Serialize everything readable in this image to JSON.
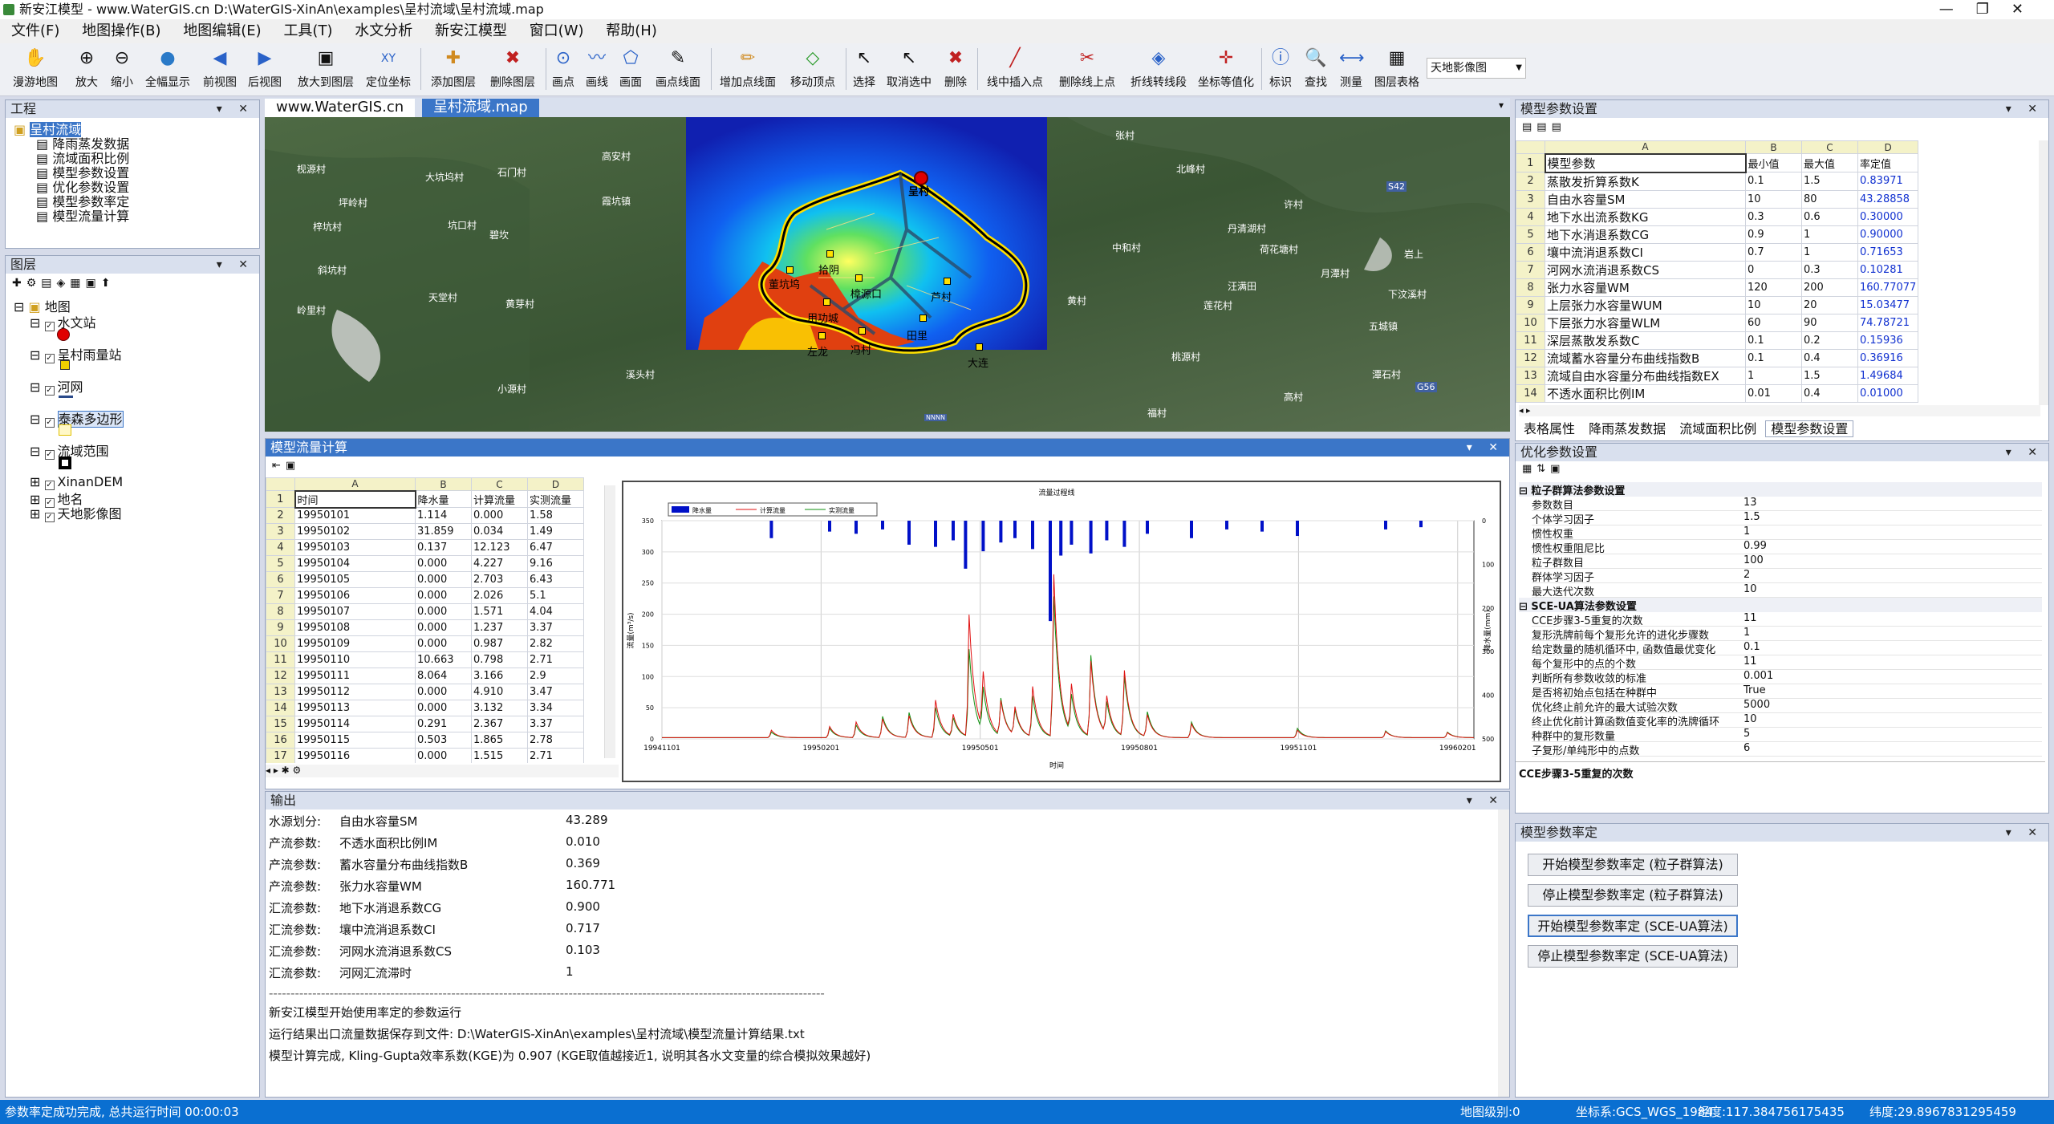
{
  "window": {
    "title": "新安江模型 - www.WaterGIS.cn  D:\\WaterGIS-XinAn\\examples\\呈村流域\\呈村流域.map",
    "controls": [
      "—",
      "❐",
      "✕"
    ]
  },
  "menu": [
    "文件(F)",
    "地图操作(B)",
    "地图编辑(E)",
    "工具(T)",
    "水文分析",
    "新安江模型",
    "窗口(W)",
    "帮助(H)"
  ],
  "toolbar": {
    "buttons": [
      "漫游地图",
      "放大",
      "缩小",
      "全幅显示",
      "前视图",
      "后视图",
      "放大到图层",
      "定位坐标",
      "添加图层",
      "删除图层",
      "画点",
      "画线",
      "画面",
      "画点线面",
      "增加点线面",
      "移动顶点",
      "选择",
      "取消选中",
      "删除",
      "线中插入点",
      "删除线上点",
      "折线转线段",
      "坐标等值化",
      "标识",
      "查找",
      "测量",
      "图层表格"
    ],
    "basemap": "天地影像图"
  },
  "project": {
    "title": "工程",
    "root": "呈村流域",
    "items": [
      "降雨蒸发数据",
      "流域面积比例",
      "模型参数设置",
      "优化参数设置",
      "模型参数率定",
      "模型流量计算"
    ]
  },
  "layers": {
    "title": "图层",
    "root": "地图",
    "items": [
      "水文站",
      "呈村雨量站",
      "河网",
      "泰森多边形",
      "流域范围",
      "XinanDEM",
      "地名",
      "天地影像图"
    ]
  },
  "map_tabs": [
    "www.WaterGIS.cn",
    "呈村流域.map"
  ],
  "map_labels": {
    "villages": [
      "枧源村",
      "坪岭村",
      "大坑坞村",
      "石门村",
      "碧坎",
      "高安村",
      "梓坑村",
      "坑口村",
      "霞坑镇",
      "斜坑村",
      "天堂村",
      "岭里村",
      "黄芽村",
      "张村",
      "中和村",
      "丹清湖村",
      "月潭村",
      "五城镇",
      "莲花村",
      "北峰村",
      "许村",
      "荷花塘村",
      "汪满田",
      "黄村",
      "岩上",
      "桃源村",
      "下汶溪村",
      "高村",
      "潭石村",
      "小源村",
      "溪头村",
      "福村"
    ],
    "stations": [
      "呈村",
      "董坑坞",
      "左龙",
      "用功城",
      "樟源口",
      "冯村",
      "芦村",
      "田里",
      "大连",
      "拾阴"
    ],
    "roads": [
      "S42",
      "G56"
    ],
    "scale": "NNNN"
  },
  "model_param": {
    "title": "模型参数设置",
    "col_letters": [
      "A",
      "B",
      "C",
      "D"
    ],
    "rows": [
      [
        "模型参数",
        "最小值",
        "最大值",
        "率定值"
      ],
      [
        "蒸散发折算系数K",
        "0.1",
        "1.5",
        "0.83971"
      ],
      [
        "自由水容量SM",
        "10",
        "80",
        "43.28858"
      ],
      [
        "地下水出流系数KG",
        "0.3",
        "0.6",
        "0.30000"
      ],
      [
        "地下水消退系数CG",
        "0.9",
        "1",
        "0.90000"
      ],
      [
        "壤中流消退系数CI",
        "0.7",
        "1",
        "0.71653"
      ],
      [
        "河网水流消退系数CS",
        "0",
        "0.3",
        "0.10281"
      ],
      [
        "张力水容量WM",
        "120",
        "200",
        "160.77077"
      ],
      [
        "上层张力水容量WUM",
        "10",
        "20",
        "15.03477"
      ],
      [
        "下层张力水容量WLM",
        "60",
        "90",
        "74.78721"
      ],
      [
        "深层蒸散发系数C",
        "0.1",
        "0.2",
        "0.15936"
      ],
      [
        "流域蓄水容量分布曲线指数B",
        "0.1",
        "0.4",
        "0.36916"
      ],
      [
        "流域自由水容量分布曲线指数EX",
        "1",
        "1.5",
        "1.49684"
      ],
      [
        "不透水面积比例IM",
        "0.01",
        "0.4",
        "0.01000"
      ]
    ],
    "tabs": [
      "表格属性",
      "降雨蒸发数据",
      "流域面积比例",
      "模型参数设置"
    ]
  },
  "flow_calc": {
    "title": "模型流量计算",
    "col_letters": [
      "A",
      "B",
      "C",
      "D"
    ],
    "rows": [
      [
        "时间",
        "降水量",
        "计算流量",
        "实测流量"
      ],
      [
        "19950101",
        "1.114",
        "0.000",
        "1.58"
      ],
      [
        "19950102",
        "31.859",
        "0.034",
        "1.49"
      ],
      [
        "19950103",
        "0.137",
        "12.123",
        "6.47"
      ],
      [
        "19950104",
        "0.000",
        "4.227",
        "9.16"
      ],
      [
        "19950105",
        "0.000",
        "2.703",
        "6.43"
      ],
      [
        "19950106",
        "0.000",
        "2.026",
        "5.1"
      ],
      [
        "19950107",
        "0.000",
        "1.571",
        "4.04"
      ],
      [
        "19950108",
        "0.000",
        "1.237",
        "3.37"
      ],
      [
        "19950109",
        "0.000",
        "0.987",
        "2.82"
      ],
      [
        "19950110",
        "10.663",
        "0.798",
        "2.71"
      ],
      [
        "19950111",
        "8.064",
        "3.166",
        "2.9"
      ],
      [
        "19950112",
        "0.000",
        "4.910",
        "3.47"
      ],
      [
        "19950113",
        "0.000",
        "3.132",
        "3.34"
      ],
      [
        "19950114",
        "0.291",
        "2.367",
        "3.37"
      ],
      [
        "19950115",
        "0.503",
        "1.865",
        "2.78"
      ],
      [
        "19950116",
        "0.000",
        "1.515",
        "2.71"
      ]
    ]
  },
  "chart_data": {
    "type": "line",
    "title": "流量过程线",
    "xlabel": "时间",
    "ylabel": "流量(m³/s)",
    "y2label": "降水量(mm)",
    "legend": [
      "降水量",
      "计算流量",
      "实测流量"
    ],
    "x_ticks": [
      "19941101",
      "19950201",
      "19950501",
      "19950801",
      "19951101",
      "19960201"
    ],
    "y_ticks": [
      "0",
      "50",
      "100",
      "150",
      "200",
      "250",
      "300",
      "350"
    ],
    "y2_ticks": [
      "0",
      "100",
      "200",
      "300",
      "400",
      "500"
    ],
    "ylim": [
      0,
      350
    ],
    "y2lim": [
      0,
      500
    ],
    "series_colors": {
      "rain": "#0010c8",
      "calc": "#e01010",
      "obs": "#109010"
    },
    "events": [
      {
        "day": 62,
        "calc": 12,
        "obs": 9
      },
      {
        "day": 95,
        "calc": 18,
        "obs": 15
      },
      {
        "day": 110,
        "calc": 25,
        "obs": 20
      },
      {
        "day": 125,
        "calc": 30,
        "obs": 34
      },
      {
        "day": 140,
        "calc": 35,
        "obs": 40
      },
      {
        "day": 155,
        "calc": 60,
        "obs": 48
      },
      {
        "day": 165,
        "calc": 35,
        "obs": 30
      },
      {
        "day": 174,
        "calc": 195,
        "obs": 140
      },
      {
        "day": 182,
        "calc": 90,
        "obs": 70
      },
      {
        "day": 192,
        "calc": 55,
        "obs": 60
      },
      {
        "day": 200,
        "calc": 45,
        "obs": 40
      },
      {
        "day": 210,
        "calc": 80,
        "obs": 65
      },
      {
        "day": 222,
        "calc": 260,
        "obs": 225
      },
      {
        "day": 232,
        "calc": 75,
        "obs": 60
      },
      {
        "day": 243,
        "calc": 120,
        "obs": 130
      },
      {
        "day": 252,
        "calc": 60,
        "obs": 50
      },
      {
        "day": 262,
        "calc": 105,
        "obs": 95
      },
      {
        "day": 275,
        "calc": 35,
        "obs": 40
      },
      {
        "day": 300,
        "calc": 22,
        "obs": 25
      },
      {
        "day": 360,
        "calc": 12,
        "obs": 15
      },
      {
        "day": 410,
        "calc": 10,
        "obs": 11
      },
      {
        "day": 445,
        "calc": 8,
        "obs": 9
      }
    ],
    "rain_bars": [
      {
        "day": 62,
        "v": 40
      },
      {
        "day": 95,
        "v": 25
      },
      {
        "day": 110,
        "v": 30
      },
      {
        "day": 125,
        "v": 20
      },
      {
        "day": 140,
        "v": 55
      },
      {
        "day": 155,
        "v": 60
      },
      {
        "day": 165,
        "v": 45
      },
      {
        "day": 172,
        "v": 110
      },
      {
        "day": 182,
        "v": 70
      },
      {
        "day": 192,
        "v": 50
      },
      {
        "day": 200,
        "v": 40
      },
      {
        "day": 210,
        "v": 65
      },
      {
        "day": 220,
        "v": 230
      },
      {
        "day": 226,
        "v": 80
      },
      {
        "day": 232,
        "v": 55
      },
      {
        "day": 243,
        "v": 75
      },
      {
        "day": 252,
        "v": 45
      },
      {
        "day": 262,
        "v": 60
      },
      {
        "day": 275,
        "v": 30
      },
      {
        "day": 300,
        "v": 40
      },
      {
        "day": 320,
        "v": 20
      },
      {
        "day": 340,
        "v": 25
      },
      {
        "day": 360,
        "v": 35
      },
      {
        "day": 410,
        "v": 20
      },
      {
        "day": 430,
        "v": 15
      }
    ]
  },
  "output": {
    "title": "输出",
    "lines": [
      [
        "水源划分:",
        "自由水容量SM",
        "43.289"
      ],
      [
        "产流参数:",
        "不透水面积比例IM",
        "0.010"
      ],
      [
        "产流参数:",
        "蓄水容量分布曲线指数B",
        "0.369"
      ],
      [
        "产流参数:",
        "张力水容量WM",
        "160.771"
      ],
      [
        "汇流参数:",
        "地下水消退系数CG",
        "0.900"
      ],
      [
        "汇流参数:",
        "壤中流消退系数CI",
        "0.717"
      ],
      [
        "汇流参数:",
        "河网水流消退系数CS",
        "0.103"
      ],
      [
        "汇流参数:",
        "河网汇流滞时",
        "1"
      ]
    ],
    "divider": "--------------------------------------------------------------------------------------------------------------------------------",
    "msg1": "新安江模型开始使用率定的参数运行",
    "msg2": "运行结果出口流量数据保存到文件: D:\\WaterGIS-XinAn\\examples\\呈村流域\\模型流量计算结果.txt",
    "msg3": "模型计算完成, Kling-Gupta效率系数(KGE)为 0.907 (KGE取值越接近1, 说明其各水文变量的综合模拟效果越好)"
  },
  "optim": {
    "title": "优化参数设置",
    "group1": "粒子群算法参数设置",
    "pso": [
      [
        "参数数目",
        "13"
      ],
      [
        "个体学习因子",
        "1.5"
      ],
      [
        "惯性权重",
        "1"
      ],
      [
        "惯性权重阻尼比",
        "0.99"
      ],
      [
        "粒子群数目",
        "100"
      ],
      [
        "群体学习因子",
        "2"
      ],
      [
        "最大迭代次数",
        "10"
      ]
    ],
    "group2": "SCE-UA算法参数设置",
    "sce": [
      [
        "CCE步骤3-5重复的次数",
        "11"
      ],
      [
        "复形洗牌前每个复形允许的进化步骤数",
        "1"
      ],
      [
        "给定数量的随机循环中, 函数值最优变化",
        "0.1"
      ],
      [
        "每个复形中的点的个数",
        "11"
      ],
      [
        "判断所有参数收敛的标准",
        "0.001"
      ],
      [
        "是否将初始点包括在种群中",
        "True"
      ],
      [
        "优化终止前允许的最大试验次数",
        "5000"
      ],
      [
        "终止优化前计算函数值变化率的洗牌循环",
        "10"
      ],
      [
        "种群中的复形数量",
        "5"
      ],
      [
        "子复形/单纯形中的点数",
        "6"
      ]
    ],
    "description": "CCE步骤3-5重复的次数"
  },
  "calib": {
    "title": "模型参数率定",
    "buttons": [
      "开始模型参数率定 (粒子群算法)",
      "停止模型参数率定 (粒子群算法)",
      "开始模型参数率定 (SCE-UA算法)",
      "停止模型参数率定 (SCE-UA算法)"
    ]
  },
  "status": {
    "message": "参数率定成功完成, 总共运行时间 00:00:03",
    "map_level": "地图级别:0",
    "crs": "坐标系:GCS_WGS_1984",
    "lon": "经度:117.384756175435",
    "lat": "纬度:29.8967831295459"
  }
}
